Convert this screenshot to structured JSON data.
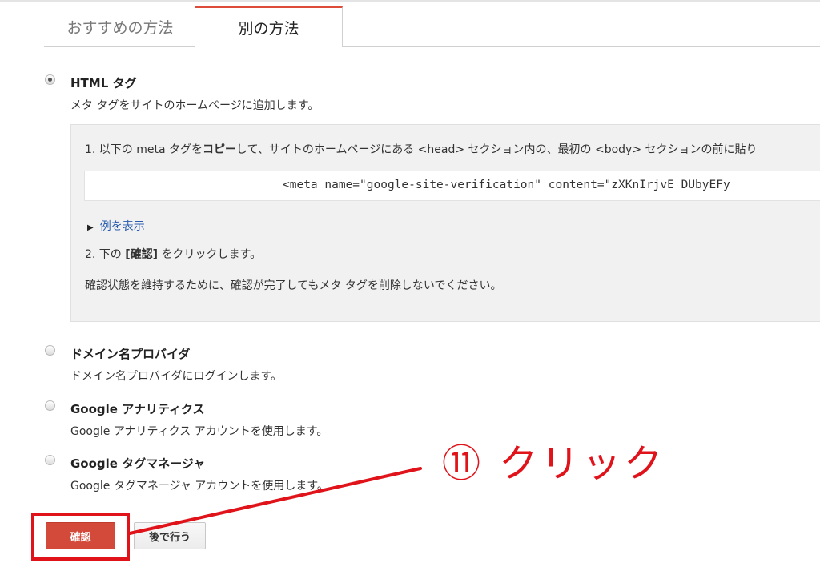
{
  "tabs": [
    {
      "label": "おすすめの方法",
      "selected": false
    },
    {
      "label": "別の方法",
      "selected": true
    }
  ],
  "options": [
    {
      "title": "HTML タグ",
      "description": "メタ タグをサイトのホームページに追加します。",
      "selected": true
    },
    {
      "title": "ドメイン名プロバイダ",
      "description": "ドメイン名プロバイダにログインします。",
      "selected": false
    },
    {
      "title": "Google アナリティクス",
      "description": "Google アナリティクス アカウントを使用します。",
      "selected": false
    },
    {
      "title": "Google タグマネージャ",
      "description": "Google タグマネージャ アカウントを使用します。",
      "selected": false
    }
  ],
  "html_tag_panel": {
    "step1_prefix": "1. 以下の meta タグを",
    "step1_bold": "コピー",
    "step1_suffix": "して、サイトのホームページにある <head> セクション内の、最初の <body> セクションの前に貼り",
    "meta_code": "<meta name=\"google-site-verification\" content=\"zXKnIrjvE_DUbyEFy",
    "show_example": "例を表示",
    "step2_prefix": "2. 下の ",
    "step2_bold": "[確認]",
    "step2_suffix": " をクリックします。",
    "note": "確認状態を維持するために、確認が完了してもメタ タグを削除しないでください。"
  },
  "buttons": {
    "confirm": "確認",
    "later": "後で行う"
  },
  "annotation": {
    "text": "⑪ クリック",
    "color": "#e0131a"
  },
  "colors": {
    "accent_red": "#d34a3a",
    "link_blue": "#2a5db0",
    "annotation_red": "#e0131a"
  }
}
